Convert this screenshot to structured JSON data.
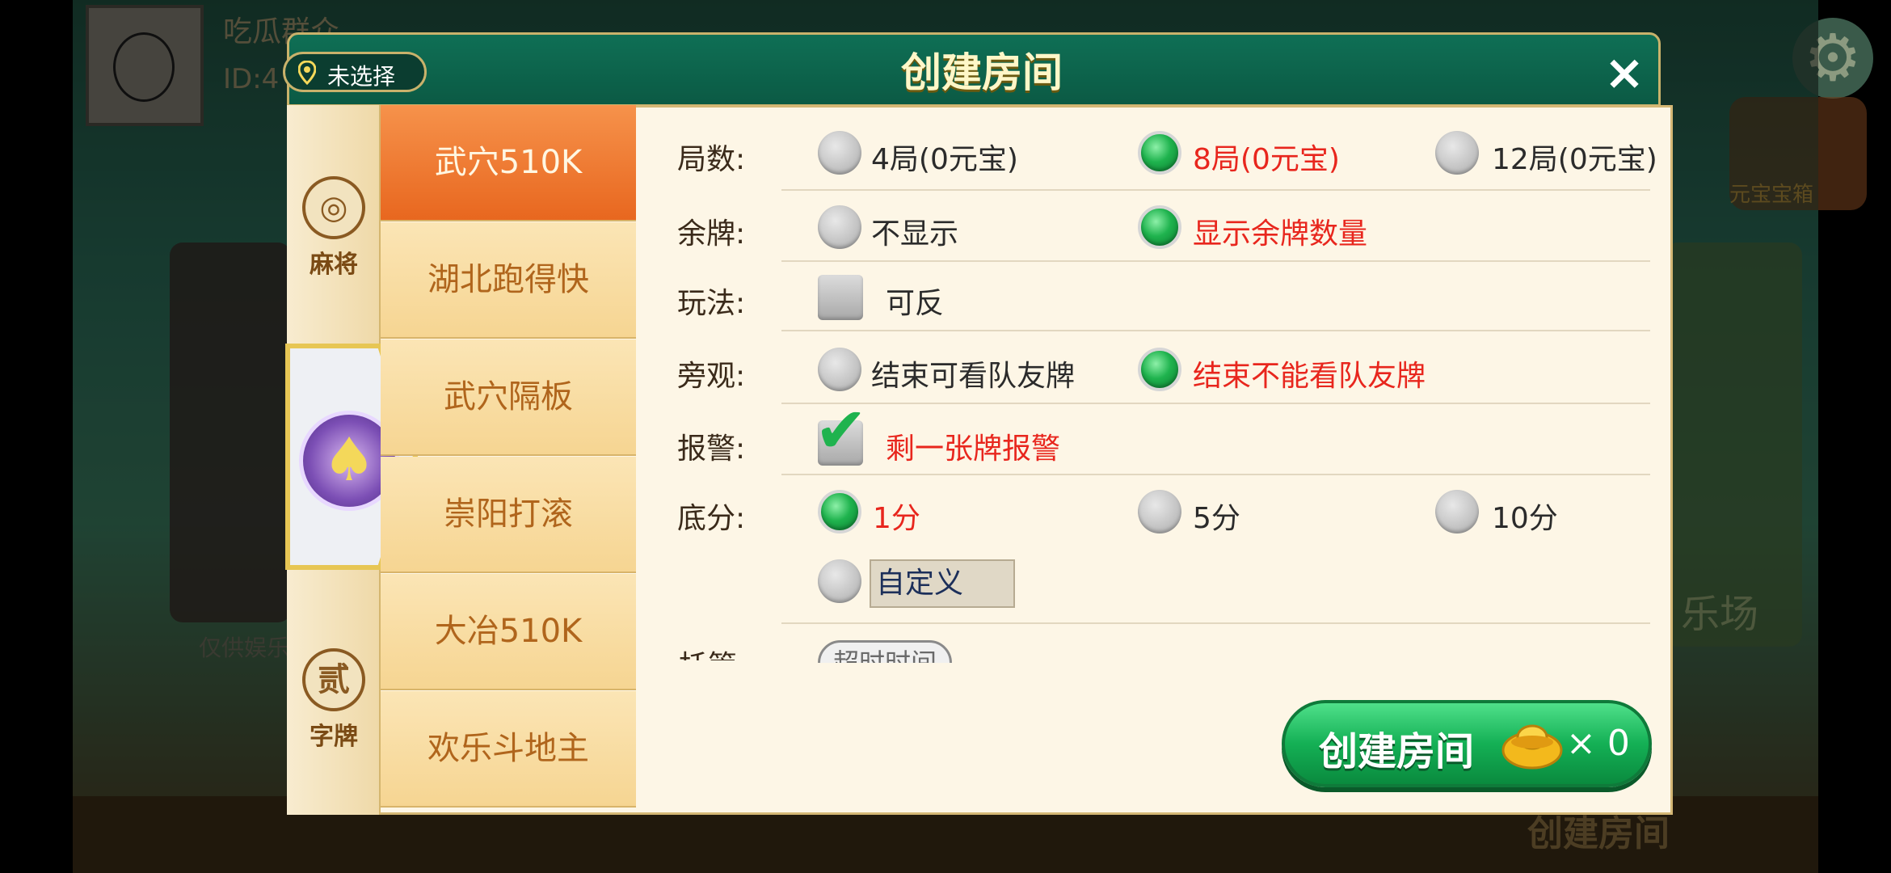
{
  "background": {
    "player_name": "吃瓜群众",
    "player_id": "ID:4",
    "chest_label": "元宝宝箱",
    "hint": "仅供娱乐",
    "right_label": "乐场",
    "bottom_button": "创建房间"
  },
  "dialog": {
    "title": "创建房间",
    "location_label": "未选择",
    "close_symbol": "×"
  },
  "categories": [
    {
      "label": "麻将",
      "icon": "mahjong-icon",
      "symbol": "◎"
    },
    {
      "label": "",
      "icon": "spade-poker-icon",
      "symbol": "♠",
      "selected": true
    },
    {
      "label": "字牌",
      "icon": "zipai-icon",
      "symbol": "贰"
    }
  ],
  "games": [
    "武穴510K",
    "湖北跑得快",
    "武穴隔板",
    "崇阳打滚",
    "大冶510K",
    "欢乐斗地主"
  ],
  "active_game_index": 0,
  "options": {
    "rounds": {
      "label": "局数:",
      "choices": [
        "4局(0元宝)",
        "8局(0元宝)",
        "12局(0元宝)"
      ],
      "selected": 1
    },
    "remaining": {
      "label": "余牌:",
      "choices": [
        "不显示",
        "显示余牌数量"
      ],
      "selected": 1
    },
    "play": {
      "label": "玩法:",
      "checkbox": "可反",
      "checked": false
    },
    "spectate": {
      "label": "旁观:",
      "choices": [
        "结束可看队友牌",
        "结束不能看队友牌"
      ],
      "selected": 1
    },
    "alarm": {
      "label": "报警:",
      "checkbox": "剩一张牌报警",
      "checked": true
    },
    "base": {
      "label": "底分:",
      "choices": [
        "1分",
        "5分",
        "10分"
      ],
      "selected": 0,
      "custom": "自定义"
    },
    "hosting": {
      "label": "托管",
      "button": "超时时间"
    }
  },
  "create": {
    "label": "创建房间",
    "cost": "× 0"
  },
  "colors": {
    "accent_green": "#14b055",
    "header_green": "#0b5a44",
    "selected_red": "#e8261d",
    "active_tab_orange": "#e8671f"
  }
}
